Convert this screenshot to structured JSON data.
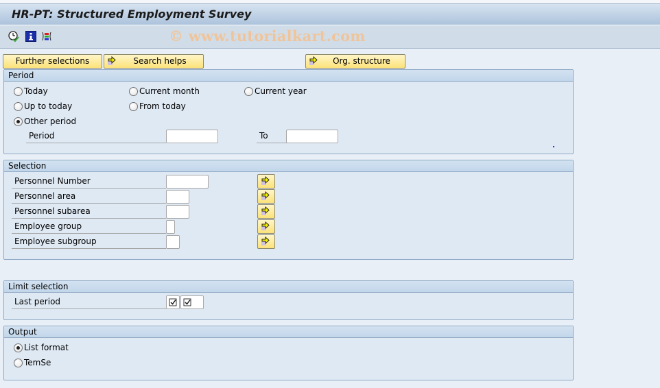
{
  "window": {
    "title": "HR-PT: Structured Employment Survey"
  },
  "toolbar": {
    "icons": [
      {
        "name": "execute-clock-icon",
        "label": "Execute"
      },
      {
        "name": "info-icon",
        "label": "Information"
      },
      {
        "name": "selection-options-icon",
        "label": "Selection options"
      }
    ],
    "watermark": "© www.tutorialkart.com"
  },
  "buttons": {
    "further_selections": "Further selections",
    "search_helps": "Search helps",
    "org_structure": "Org. structure"
  },
  "period": {
    "heading": "Period",
    "options": [
      {
        "label": "Today",
        "selected": false
      },
      {
        "label": "Current month",
        "selected": false
      },
      {
        "label": "Current year",
        "selected": false
      },
      {
        "label": "Up to today",
        "selected": false
      },
      {
        "label": "From today",
        "selected": false
      },
      {
        "label": "Other period",
        "selected": true
      }
    ],
    "period_label": "Period",
    "period_from": "",
    "to_label": "To",
    "period_to": ""
  },
  "selection": {
    "heading": "Selection",
    "fields": [
      {
        "label": "Personnel Number",
        "value": ""
      },
      {
        "label": "Personnel area",
        "value": ""
      },
      {
        "label": "Personnel subarea",
        "value": ""
      },
      {
        "label": "Employee group",
        "value": ""
      },
      {
        "label": "Employee subgroup",
        "value": ""
      }
    ]
  },
  "limit_selection": {
    "heading": "Limit selection",
    "last_period_label": "Last period",
    "checkbox1_checked": true,
    "checkbox2_checked": true
  },
  "output": {
    "heading": "Output",
    "options": [
      {
        "label": "List format",
        "selected": true
      },
      {
        "label": "TemSe",
        "selected": false
      }
    ]
  }
}
